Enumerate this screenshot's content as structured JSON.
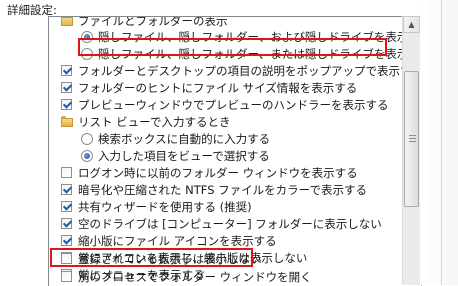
{
  "section_label": "詳細設定:",
  "items": [
    {
      "type": "folder",
      "label": "ファイルとフォルダーの表示"
    },
    {
      "type": "radio",
      "checked": true,
      "label": "隠しファイル、隠しフォルダー、および隠しドライブを表示する",
      "highlight": true
    },
    {
      "type": "radio",
      "checked": false,
      "label": "隠しファイル、隠しフォルダー、または隠しドライブを表示しない"
    },
    {
      "type": "checkbox",
      "checked": true,
      "label": "フォルダーとデスクトップの項目の説明をポップアップで表示する"
    },
    {
      "type": "checkbox",
      "checked": true,
      "label": "フォルダーのヒントにファイル サイズ情報を表示する"
    },
    {
      "type": "checkbox",
      "checked": true,
      "label": "プレビューウィンドウでプレビューのハンドラーを表示する"
    },
    {
      "type": "folder",
      "label": "リスト ビューで入力するとき"
    },
    {
      "type": "radio",
      "checked": false,
      "label": "検索ボックスに自動的に入力する"
    },
    {
      "type": "radio",
      "checked": true,
      "label": "入力した項目をビューで選択する"
    },
    {
      "type": "checkbox",
      "checked": false,
      "label": "ログオン時に以前のフォルダー ウィンドウを表示する"
    },
    {
      "type": "checkbox",
      "checked": true,
      "label": "暗号化や圧縮された NTFS ファイルをカラーで表示する"
    },
    {
      "type": "checkbox",
      "checked": true,
      "label": "共有ウィザードを使用する (推奨)"
    },
    {
      "type": "checkbox",
      "checked": true,
      "label": "空のドライブは [コンピューター] フォルダーに表示しない"
    },
    {
      "type": "checkbox",
      "checked": true,
      "label": "縮小版にファイル アイコンを表示する"
    },
    {
      "type": "checkbox",
      "checked": false,
      "label": "常にアイコンを表示し、縮小版は表示しない"
    },
    {
      "type": "checkbox",
      "checked": false,
      "label": "常にメニューを表示する"
    },
    {
      "type": "checkbox",
      "checked": false,
      "label": "登録されている拡張子は表示しない",
      "highlight": true
    },
    {
      "type": "checkbox",
      "checked": false,
      "label": "別のプロセスでフォルダー ウィンドウを開く"
    }
  ],
  "scroll_up_icon": "chevron-up-icon",
  "scroll_down_icon": "chevron-down-icon"
}
